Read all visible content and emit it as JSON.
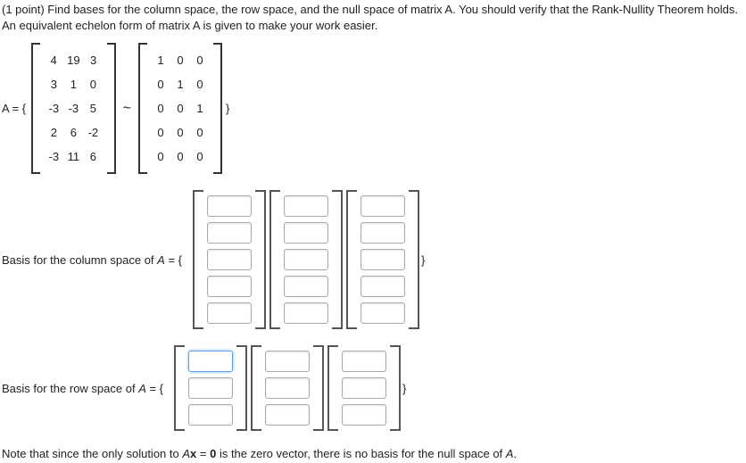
{
  "intro": "(1 point) Find bases for the column space, the row space, and the null space of matrix A. You should verify that the Rank-Nullity Theorem holds. An equivalent echelon form of matrix A is given to make your work easier.",
  "eq_prefix": "A = {",
  "matrixA": [
    [
      "4",
      "19",
      "3"
    ],
    [
      "3",
      "1",
      "0"
    ],
    [
      "-3",
      "-3",
      "5"
    ],
    [
      "2",
      "6",
      "-2"
    ],
    [
      "-3",
      "11",
      "6"
    ]
  ],
  "tilde": "~",
  "matrixE": [
    [
      "1",
      "0",
      "0"
    ],
    [
      "0",
      "1",
      "0"
    ],
    [
      "0",
      "0",
      "1"
    ],
    [
      "0",
      "0",
      "0"
    ],
    [
      "0",
      "0",
      "0"
    ]
  ],
  "close_brace": "}",
  "col_label_pre": "Basis for the column space of ",
  "A_text": "A",
  "eq_open": " = {",
  "row_label_pre": "Basis for the row space of ",
  "note_pre": "Note that since the only solution to ",
  "note_ax": "Ax = 0",
  "note_mid": " is the zero vector, there is no basis for the null space of ",
  "note_end": "."
}
